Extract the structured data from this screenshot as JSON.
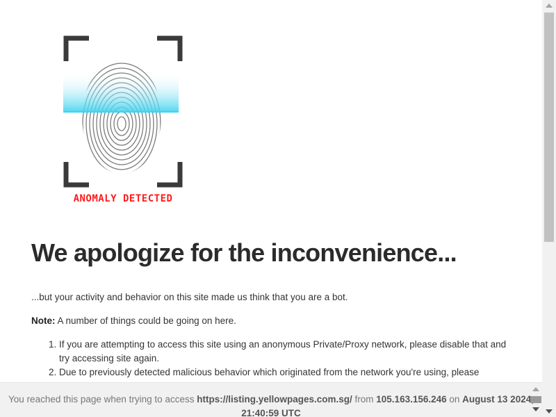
{
  "logo": {
    "caption": "ANOMALY DETECTED",
    "icon": "fingerprint-scan-icon",
    "caption_color": "#ff1a1a",
    "scan_color": "#3fd3ef"
  },
  "main": {
    "title": "We apologize for the inconvenience...",
    "intro": "...but your activity and behavior on this site made us think that you are a bot.",
    "note_label": "Note:",
    "note_text": " A number of things could be going on here.",
    "reasons": [
      "If you are attempting to access this site using an anonymous Private/Proxy network, please disable that and try accessing site again.",
      "Due to previously detected malicious behavior which originated from the network you're using, please"
    ]
  },
  "footer": {
    "prefix": "You reached this page when trying to access ",
    "url": "https://listing.yellowpages.com.sg/",
    "from_label": " from ",
    "ip": "105.163.156.246",
    "on_label": " on ",
    "datetime": "August 13 2024, 21:40:59 UTC"
  }
}
